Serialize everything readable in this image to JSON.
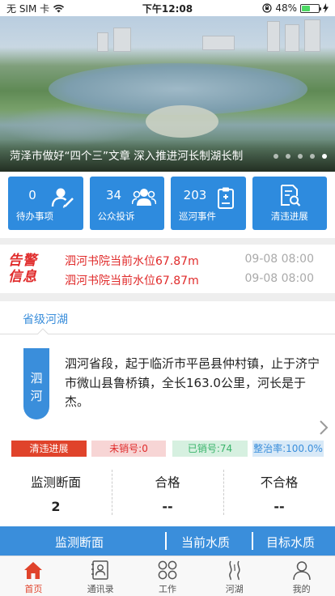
{
  "status_bar": {
    "carrier": "无 SIM 卡",
    "time": "下午12:08",
    "battery": "48%",
    "battery_level": 0.48
  },
  "banner": {
    "caption": "菏泽市做好“四个三”文章 深入推进河长制湖长制",
    "dots": 5,
    "active_dot": 5
  },
  "tiles": [
    {
      "count": "0",
      "label": "待办事项",
      "icon": "user-edit-icon"
    },
    {
      "count": "34",
      "label": "公众投诉",
      "icon": "group-users-icon"
    },
    {
      "count": "203",
      "label": "巡河事件",
      "icon": "clipboard-icon"
    },
    {
      "label": "清违进展",
      "icon": "document-search-icon"
    }
  ],
  "alerts": {
    "logo_line1": "告警",
    "logo_line2": "信息",
    "items": [
      {
        "text": "泗河书院当前水位67.87m",
        "time": "09-08 08:00"
      },
      {
        "text": "泗河书院当前水位67.87m",
        "time": "09-08 08:00"
      }
    ]
  },
  "section": {
    "tab": "省级河湖"
  },
  "river": {
    "name_line1": "泗",
    "name_line2": "河",
    "description": "泗河省段，起于临沂市平邑县仲村镇，止于济宁市微山县鲁桥镇，全长163.0公里，河长是于杰。"
  },
  "badges": {
    "progress": "清违进展",
    "unsold": "未销号:0",
    "sold": "已销号:74",
    "rate": "整治率:100.0%"
  },
  "stats": [
    {
      "label": "监测断面",
      "value": "2"
    },
    {
      "label": "合格",
      "value": "--"
    },
    {
      "label": "不合格",
      "value": "--"
    }
  ],
  "bluebar": {
    "col1": "监测断面",
    "col2": "当前水质",
    "col3": "目标水质"
  },
  "tabbar": [
    {
      "label": "首页",
      "icon": "home-icon",
      "active": true
    },
    {
      "label": "通讯录",
      "icon": "contacts-icon"
    },
    {
      "label": "工作",
      "icon": "grid-icon"
    },
    {
      "label": "河湖",
      "icon": "river-icon"
    },
    {
      "label": "我的",
      "icon": "person-icon"
    }
  ],
  "colors": {
    "primary_blue": "#3a8edb",
    "tile_blue": "#2e8bde",
    "alert_red": "#e02b2b",
    "active_tab": "#e0432b"
  }
}
